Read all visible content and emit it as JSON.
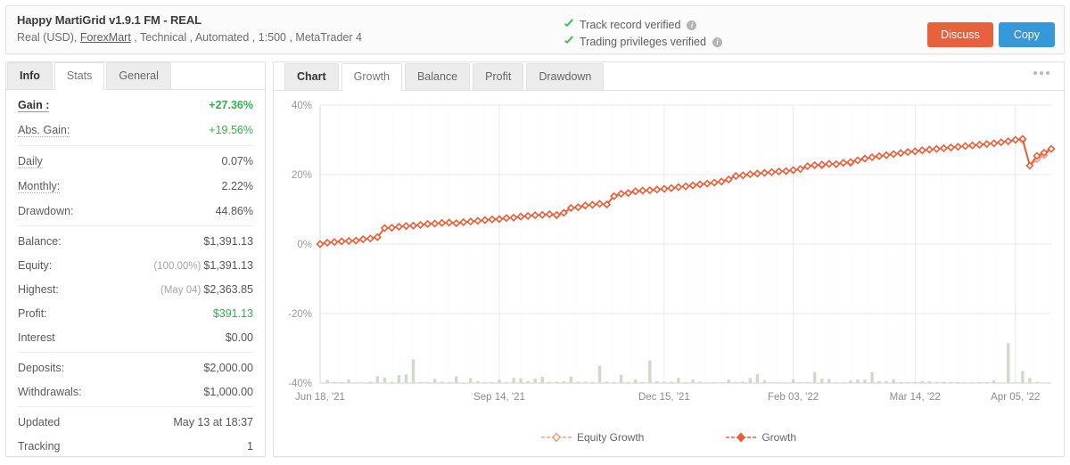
{
  "header": {
    "title": "Happy MartiGrid v1.9.1 FM - REAL",
    "subtitle_pre": "Real (USD), ",
    "broker_link": "ForexMart",
    "subtitle_post": " , Technical , Automated , 1:500 , MetaTrader 4",
    "verified": [
      {
        "label": "Track record verified",
        "icon": "check-icon",
        "info": "i"
      },
      {
        "label": "Trading privileges verified",
        "icon": "check-icon",
        "info": "i"
      }
    ],
    "buttons": {
      "discuss": "Discuss",
      "copy": "Copy"
    },
    "colors": {
      "discuss": "#e8603c",
      "copy": "#3498db",
      "verified_check": "#3ebd56"
    }
  },
  "sidebar": {
    "tabs": [
      {
        "label": "Info",
        "active": false,
        "bold": true
      },
      {
        "label": "Stats",
        "active": true,
        "bold": false
      },
      {
        "label": "General",
        "active": false,
        "bold": false
      }
    ],
    "groups": [
      {
        "rows": [
          {
            "key": "Gain :",
            "value": "+27.36%",
            "style": "greenb",
            "keystyle": "bold"
          },
          {
            "key": "Abs. Gain:",
            "value": "+19.56%",
            "style": "green",
            "keystyle": "u"
          }
        ]
      },
      {
        "rows": [
          {
            "key": "Daily",
            "value": "0.07%",
            "style": "",
            "keystyle": "u"
          },
          {
            "key": "Monthly:",
            "value": "2.22%",
            "style": "",
            "keystyle": "u"
          },
          {
            "key": "Drawdown:",
            "value": "44.86%",
            "style": "",
            "keystyle": ""
          }
        ]
      },
      {
        "rows": [
          {
            "key": "Balance:",
            "value": "$1,391.13",
            "style": "",
            "keystyle": ""
          },
          {
            "key": "Equity:",
            "value": "$1,391.13",
            "note": "(100.00%)",
            "style": "",
            "keystyle": ""
          },
          {
            "key": "Highest:",
            "value": "$2,363.85",
            "note": "(May 04)",
            "style": "",
            "keystyle": ""
          },
          {
            "key": "Profit:",
            "value": "$391.13",
            "style": "green",
            "keystyle": ""
          },
          {
            "key": "Interest",
            "value": "$0.00",
            "style": "",
            "keystyle": ""
          }
        ]
      },
      {
        "rows": [
          {
            "key": "Deposits:",
            "value": "$2,000.00",
            "style": "",
            "keystyle": ""
          },
          {
            "key": "Withdrawals:",
            "value": "$1,000.00",
            "style": "",
            "keystyle": ""
          }
        ]
      },
      {
        "rows": [
          {
            "key": "Updated",
            "value": "May 13 at 18:37",
            "style": "",
            "keystyle": ""
          },
          {
            "key": "Tracking",
            "value": "1",
            "style": "",
            "keystyle": ""
          }
        ]
      }
    ]
  },
  "chart_panel": {
    "tabs": [
      {
        "label": "Chart",
        "active": false,
        "bold": true
      },
      {
        "label": "Growth",
        "active": true,
        "bold": false
      },
      {
        "label": "Balance",
        "active": false,
        "bold": false
      },
      {
        "label": "Profit",
        "active": false,
        "bold": false
      },
      {
        "label": "Drawdown",
        "active": false,
        "bold": false
      }
    ],
    "menu_icon": "kebab-menu-icon"
  },
  "chart_data": {
    "type": "line",
    "title": "",
    "xlabel": "",
    "ylabel": "",
    "ylim": [
      -40,
      40
    ],
    "yticks": [
      40,
      20,
      0,
      -20,
      -40
    ],
    "ytick_labels": [
      "40%",
      "20%",
      "0%",
      "-20%",
      "-40%"
    ],
    "grid": true,
    "legend_position": "bottom",
    "colors": {
      "growth": "#e8603c",
      "equity_growth": "#f0a080",
      "bars": "#cfdac8"
    },
    "xtick_labels": [
      "Jun 18, '21",
      "Sep 14, '21",
      "Dec 15, '21",
      "Feb 03, '22",
      "Mar 14, '22",
      "Apr 05, '22"
    ],
    "xtick_positions": [
      0,
      25,
      48,
      66,
      83,
      97
    ],
    "series": [
      {
        "name": "Growth",
        "marker": "diamond-filled",
        "values": [
          0.0,
          0.4,
          0.6,
          0.8,
          0.9,
          1.0,
          1.4,
          1.6,
          2.0,
          4.6,
          4.7,
          5.0,
          5.2,
          5.3,
          5.5,
          5.8,
          5.9,
          6.1,
          6.2,
          6.0,
          6.3,
          6.5,
          6.7,
          6.9,
          7.1,
          7.2,
          7.5,
          7.6,
          7.9,
          8.1,
          8.3,
          8.4,
          8.6,
          8.4,
          9.0,
          10.4,
          10.6,
          11.1,
          11.3,
          11.6,
          11.4,
          13.8,
          14.5,
          14.7,
          15.2,
          15.4,
          15.5,
          15.7,
          15.9,
          16.1,
          16.4,
          16.6,
          16.9,
          17.2,
          17.4,
          17.7,
          18.0,
          18.6,
          19.6,
          19.8,
          20.1,
          20.3,
          20.5,
          20.7,
          20.9,
          21.0,
          21.3,
          21.6,
          22.4,
          22.7,
          22.9,
          23.1,
          23.0,
          23.4,
          23.6,
          24.1,
          24.6,
          25.0,
          25.3,
          25.6,
          25.9,
          26.2,
          26.5,
          26.7,
          27.0,
          27.2,
          27.4,
          27.6,
          27.8,
          28.0,
          28.2,
          28.4,
          28.6,
          28.8,
          29.0,
          29.3,
          29.6,
          30.0,
          30.3,
          22.6,
          25.4,
          26.3,
          27.4
        ]
      },
      {
        "name": "Equity Growth",
        "marker": "diamond-hollow",
        "values": [
          0.0,
          0.4,
          0.6,
          0.8,
          0.9,
          1.0,
          1.4,
          1.6,
          2.0,
          4.6,
          4.7,
          5.0,
          5.2,
          5.3,
          5.5,
          5.8,
          5.9,
          6.1,
          6.2,
          6.0,
          6.3,
          6.5,
          6.7,
          6.9,
          7.1,
          7.2,
          7.5,
          7.6,
          7.9,
          8.1,
          8.3,
          8.4,
          8.6,
          8.2,
          9.0,
          10.4,
          10.6,
          11.1,
          11.3,
          11.6,
          11.4,
          13.8,
          14.5,
          14.7,
          15.2,
          15.4,
          15.5,
          15.7,
          15.9,
          16.1,
          16.4,
          16.6,
          16.9,
          17.2,
          17.4,
          17.7,
          18.0,
          18.6,
          19.6,
          19.8,
          20.1,
          20.3,
          20.5,
          20.7,
          20.9,
          21.0,
          21.3,
          21.6,
          22.4,
          22.7,
          22.6,
          23.1,
          23.0,
          23.4,
          23.2,
          24.1,
          24.6,
          25.0,
          25.3,
          25.6,
          25.9,
          26.2,
          26.5,
          26.7,
          27.0,
          27.2,
          27.4,
          27.6,
          27.8,
          28.0,
          28.2,
          28.4,
          28.6,
          28.8,
          29.0,
          29.3,
          29.6,
          30.0,
          29.9,
          22.6,
          24.4,
          25.6,
          27.4
        ]
      }
    ],
    "bars": {
      "name": "Volume",
      "baseline": -40,
      "values": [
        0,
        0.9,
        0.3,
        0.3,
        1.0,
        0.2,
        0.2,
        0.4,
        2.0,
        1.6,
        0.4,
        2.3,
        2.5,
        6.8,
        0.3,
        0.3,
        1.2,
        0.4,
        0.3,
        1.9,
        0.2,
        1.4,
        0.6,
        0.3,
        0.3,
        1.0,
        0.3,
        1.5,
        1.4,
        0.6,
        1.3,
        1.8,
        0.3,
        0.4,
        0.5,
        1.9,
        0.4,
        0.4,
        0.3,
        5.0,
        0.4,
        0.3,
        2.4,
        0.4,
        1.0,
        0.3,
        6.5,
        0.5,
        0.4,
        0.4,
        1.5,
        0.3,
        1.0,
        0.4,
        0.2,
        0.3,
        0.2,
        1.0,
        0.3,
        0.4,
        1.4,
        2.6,
        0.8,
        0.2,
        0.2,
        0.2,
        1.1,
        0.3,
        0.3,
        3.2,
        1.3,
        1.2,
        0.2,
        0.2,
        0.7,
        1.0,
        1.0,
        3.1,
        0.5,
        0.6,
        1.1,
        0.3,
        0.3,
        0.3,
        0.6,
        0.5,
        0.3,
        0.4,
        0.3,
        0.3,
        0.2,
        0.2,
        0.3,
        0.3,
        0.8,
        0.2,
        11.5,
        0.2,
        3.5,
        1.5,
        0.3
      ]
    },
    "legend": [
      {
        "name": "Equity Growth",
        "marker": "diamond-hollow",
        "color": "#f0a080"
      },
      {
        "name": "Growth",
        "marker": "diamond-filled",
        "color": "#e8603c"
      }
    ]
  }
}
